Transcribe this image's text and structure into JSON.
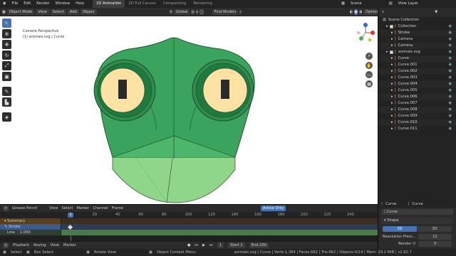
{
  "topbar": {
    "menus": [
      "File",
      "Edit",
      "Render",
      "Window",
      "Help"
    ],
    "workspaces": [
      "2D Animation",
      "2D Full Canvas",
      "Compositing",
      "Rendering"
    ],
    "scene": "Scene",
    "view_layer": "View Layer"
  },
  "vp_header": {
    "mode": "Object Mode",
    "view": "View",
    "select": "Select",
    "add": "Add",
    "object": "Object",
    "orientation": "Global",
    "find_models": "Find Models",
    "options": "Options"
  },
  "viewport": {
    "perspective": "Camera Perspective",
    "object_info": "(1) animals.svg | Curve"
  },
  "outliner": {
    "title": "Scene Collection",
    "items": [
      {
        "name": "Collection",
        "indent": 1
      },
      {
        "name": "Stroke",
        "indent": 2
      },
      {
        "name": "Camera",
        "indent": 2
      },
      {
        "name": "Camera",
        "indent": 2
      },
      {
        "name": "animals.svg",
        "indent": 1
      },
      {
        "name": "Curve",
        "indent": 2
      },
      {
        "name": "Curve.001",
        "indent": 2
      },
      {
        "name": "Curve.002",
        "indent": 2
      },
      {
        "name": "Curve.003",
        "indent": 2
      },
      {
        "name": "Curve.004",
        "indent": 2
      },
      {
        "name": "Curve.005",
        "indent": 2
      },
      {
        "name": "Curve.006",
        "indent": 2
      },
      {
        "name": "Curve.007",
        "indent": 2
      },
      {
        "name": "Curve.008",
        "indent": 2
      },
      {
        "name": "Curve.009",
        "indent": 2
      },
      {
        "name": "Curve.010",
        "indent": 2
      },
      {
        "name": "Curve.011",
        "indent": 2
      }
    ]
  },
  "props": {
    "tab1": "Curve",
    "tab2": "Curve",
    "datablock": "Curve",
    "section": "Shape",
    "dim2d": "2D",
    "dim3d": "3D",
    "resolution_label": "Resolution Previ...",
    "resolution_value": "12",
    "render_u_label": "Render U",
    "render_u_value": "0"
  },
  "timeline": {
    "mode": "Grease Pencil",
    "menus": [
      "View",
      "Select",
      "Marker",
      "Channel",
      "Frame"
    ],
    "active_only": "Active Only",
    "frame_ticks": [
      "0",
      "20",
      "40",
      "60",
      "80",
      "100",
      "120",
      "140",
      "160",
      "180",
      "200",
      "220",
      "240"
    ],
    "current_frame": "1",
    "summary": "Summary",
    "stroke": "Stroke",
    "line_label": "Line",
    "line_value": "1.000",
    "playback": "Playback",
    "keying": "Keying",
    "view": "View",
    "marker": "Marker",
    "frame": "1",
    "start_label": "Start",
    "start": "1",
    "end_label": "End",
    "end": "250"
  },
  "status": {
    "select": "Select",
    "box_select": "Box Select",
    "rotate_view": "Rotate View",
    "context_menu": "Object Context Menu",
    "stats": "animals.svg | Curve | Verts:1,364 | Faces:662 | Tris:662 | Objects:0/14 | Mem: 29.2 MiB | v2.82.7"
  },
  "colors": {
    "head": "#3aa45e",
    "head_dark": "#2e8c4f",
    "eye_ring": "#1f7a40",
    "eye_white": "#fde2a4",
    "pupil": "#2b2b2b",
    "jaw": "#8fd68a",
    "accent": "#4772b3"
  }
}
